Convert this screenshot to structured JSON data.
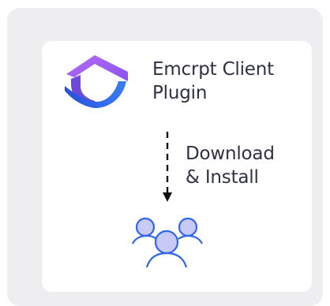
{
  "brand": {
    "name_line1": "Emcrpt Client",
    "name_line2": "Plugin",
    "logo_icon": "shield-roof-logo",
    "colors": {
      "purple": "#9b5cf6",
      "blue": "#2f66e8",
      "violet": "#6f4ad9"
    }
  },
  "flow": {
    "action_line1": "Download",
    "action_line2": "& Install",
    "arrow_icon": "dashed-down-arrow"
  },
  "audience": {
    "icon": "users-group-icon",
    "fill": "#c9c9f5",
    "stroke": "#2f66e8"
  }
}
